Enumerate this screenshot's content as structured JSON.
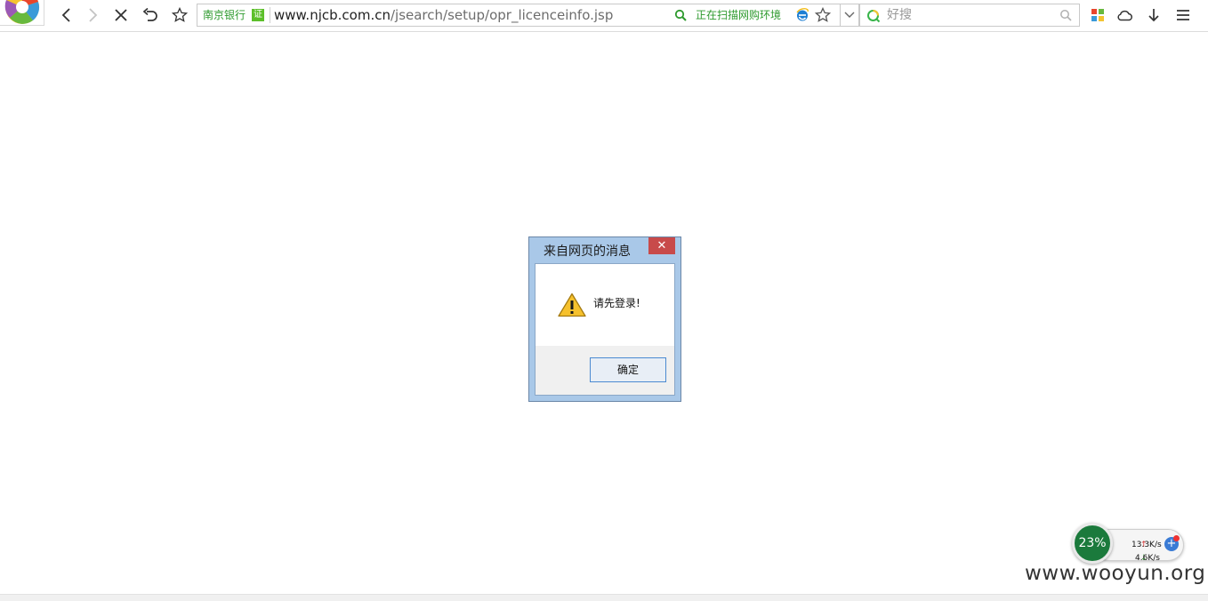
{
  "browser": {
    "site_name": "南京银行",
    "cert_badge": "证",
    "url_host": "www.njcb.com.cn",
    "url_path": "/jsearch/setup/opr_licenceinfo.jsp",
    "scan_status": "正在扫描网购环境",
    "search_placeholder": "好搜"
  },
  "dialog": {
    "title": "来自网页的消息",
    "close_label": "✕",
    "message": "请先登录!",
    "ok_label": "确定"
  },
  "speed_widget": {
    "percent": "23%",
    "upload": "13.3K/s",
    "download": "4.6K/s",
    "plus_label": "+"
  },
  "watermark": "www.wooyun.org",
  "colors": {
    "secure_green": "#2e9a2e",
    "dialog_frame": "#a9c8e8",
    "close_red": "#c84a4a",
    "widget_green": "#1b7a3c"
  }
}
